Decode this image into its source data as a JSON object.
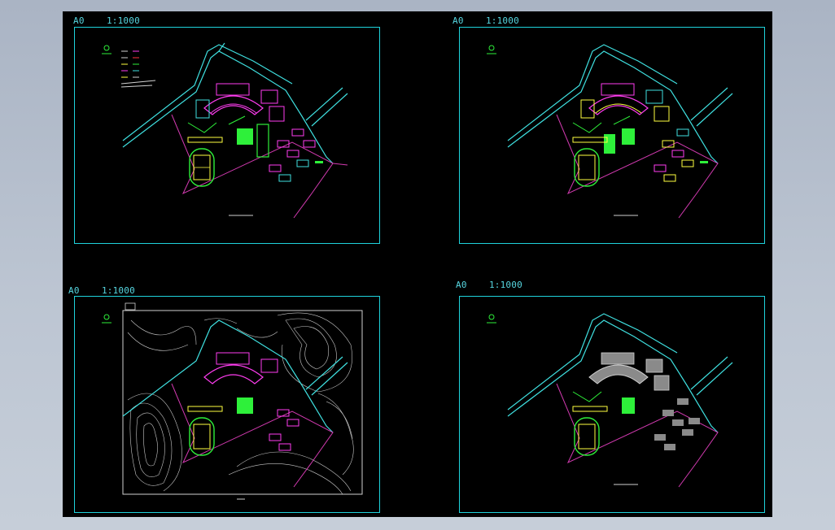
{
  "viewport": {
    "background_color": "#000000"
  },
  "colors": {
    "frame": "#1fd3dc",
    "road": "#3fe0e0",
    "building_magenta": "#ff3df0",
    "building_green": "#2ef03a",
    "site_line": "#d23ab0",
    "contour": "#d0d0d0",
    "label": "#56d6e0"
  },
  "sheets": [
    {
      "id": "sheet-top-left",
      "size_label": "A0",
      "scale_label": "1:1000",
      "variant": "colored-plan"
    },
    {
      "id": "sheet-top-right",
      "size_label": "A0",
      "scale_label": "1:1000",
      "variant": "colored-plan"
    },
    {
      "id": "sheet-bottom-left",
      "size_label": "A0",
      "scale_label": "1:1000",
      "variant": "topographic-plan"
    },
    {
      "id": "sheet-bottom-right",
      "size_label": "A0",
      "scale_label": "1:1000",
      "variant": "grey-plan"
    }
  ]
}
